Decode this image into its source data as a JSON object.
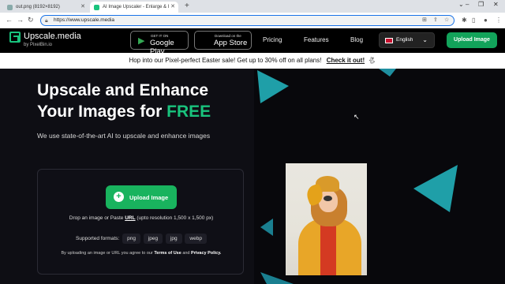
{
  "browser": {
    "tabs": [
      {
        "title": "out.png (8192×8192)"
      },
      {
        "title": "AI Image Upscaler - Enlarge & I"
      }
    ],
    "url": "https://www.upscale.media"
  },
  "site": {
    "brand": "Upscale.media",
    "brand_sub": "by PixelBin.io",
    "stores": [
      {
        "small": "GET IT ON",
        "big": "Google Play"
      },
      {
        "small": "Download on the",
        "big": "App Store"
      }
    ],
    "nav": [
      "Pricing",
      "Features",
      "Blog"
    ],
    "language": "English",
    "upload_top": "Upload Image"
  },
  "banner": {
    "text": "Hop into our Pixel-perfect Easter sale! Get up to 30% off on all plans!",
    "link": "Check it out!"
  },
  "hero": {
    "title_line1": "Upscale and Enhance",
    "title_line2_prefix": "Your Images for ",
    "title_free": "FREE",
    "subtitle": "We use state-of-the-art AI to upscale and enhance images",
    "upload_button": "Upload Image",
    "drop_prefix": "Drop an image or Paste",
    "drop_url": "URL",
    "drop_suffix": "(upto resolution 1,500 x 1,500 px)",
    "formats_label": "Supported formats:",
    "formats": [
      "png",
      "jpeg",
      "jpg",
      "webp"
    ],
    "terms_prefix": "By uploading an image or URL you agree to our",
    "terms_link": "Terms of Use",
    "terms_and": "and",
    "privacy_link": "Privacy Policy."
  },
  "colors": {
    "accent": "#19c37d",
    "triangle": "#1f8fa0"
  }
}
